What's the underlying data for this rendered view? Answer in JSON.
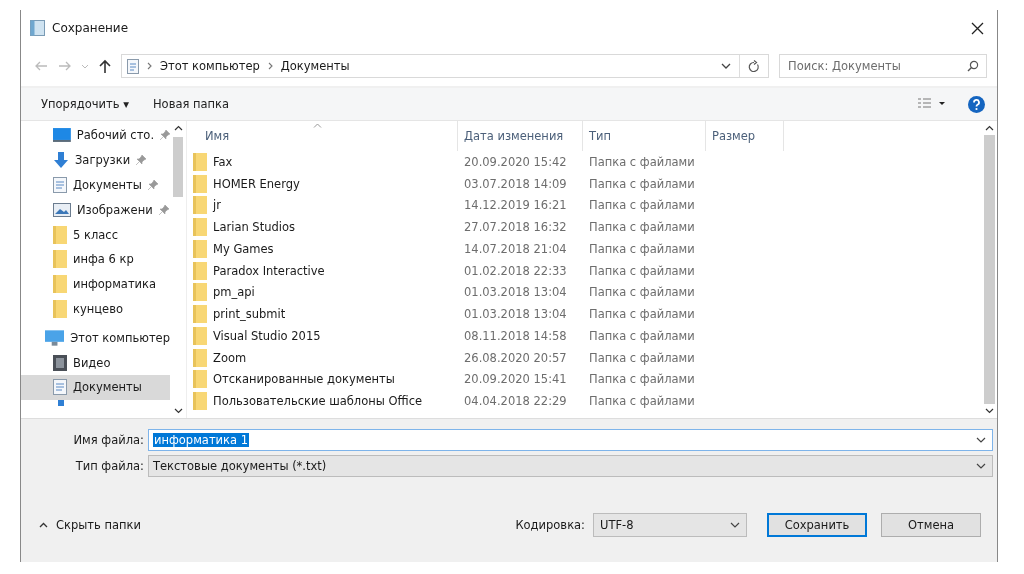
{
  "window": {
    "title": "Сохранение"
  },
  "address": {
    "path": [
      "Этот компьютер",
      "Документы"
    ]
  },
  "search": {
    "placeholder": "Поиск: Документы"
  },
  "toolbar": {
    "organize": "Упорядочить ▾",
    "new_folder": "Новая папка"
  },
  "sidebar": {
    "items": [
      {
        "label": "Рабочий сто.",
        "kind": "desktop",
        "pinned": true,
        "selected": false
      },
      {
        "label": "Загрузки",
        "kind": "download",
        "pinned": true,
        "selected": false
      },
      {
        "label": "Документы",
        "kind": "documents",
        "pinned": true,
        "selected": false
      },
      {
        "label": "Изображени",
        "kind": "pictures",
        "pinned": true,
        "selected": false
      },
      {
        "label": "5 класс",
        "kind": "folder",
        "pinned": false,
        "selected": false
      },
      {
        "label": "инфа 6 кр",
        "kind": "folder",
        "pinned": false,
        "selected": false
      },
      {
        "label": "информатика",
        "kind": "folder",
        "pinned": false,
        "selected": false
      },
      {
        "label": "кунцево",
        "kind": "folder",
        "pinned": false,
        "selected": false
      },
      {
        "label": "Этот компьютер",
        "kind": "computer",
        "pinned": false,
        "selected": false,
        "children": [
          {
            "label": "Видео",
            "kind": "video",
            "pinned": false,
            "selected": false
          },
          {
            "label": "Документы",
            "kind": "documents",
            "pinned": false,
            "selected": true
          }
        ]
      }
    ]
  },
  "table": {
    "columns": [
      "Имя",
      "Дата изменения",
      "Тип",
      "Размер"
    ],
    "rows": [
      {
        "name": "Fax",
        "date": "20.09.2020 15:42",
        "type": "Папка с файлами"
      },
      {
        "name": "HOMER Energy",
        "date": "03.07.2018 14:09",
        "type": "Папка с файлами"
      },
      {
        "name": "jr",
        "date": "14.12.2019 16:21",
        "type": "Папка с файлами"
      },
      {
        "name": "Larian Studios",
        "date": "27.07.2018 16:32",
        "type": "Папка с файлами"
      },
      {
        "name": "My Games",
        "date": "14.07.2018 21:04",
        "type": "Папка с файлами"
      },
      {
        "name": "Paradox Interactive",
        "date": "01.02.2018 22:33",
        "type": "Папка с файлами"
      },
      {
        "name": "pm_api",
        "date": "01.03.2018 13:04",
        "type": "Папка с файлами"
      },
      {
        "name": "print_submit",
        "date": "01.03.2018 13:04",
        "type": "Папка с файлами"
      },
      {
        "name": "Visual Studio 2015",
        "date": "08.11.2018 14:58",
        "type": "Папка с файлами"
      },
      {
        "name": "Zoom",
        "date": "26.08.2020 20:57",
        "type": "Папка с файлами"
      },
      {
        "name": "Отсканированные документы",
        "date": "20.09.2020 15:41",
        "type": "Папка с файлами"
      },
      {
        "name": "Пользовательские шаблоны Office",
        "date": "04.04.2018 22:29",
        "type": "Папка с файлами"
      }
    ]
  },
  "file_name": {
    "label": "Имя файла:",
    "value": "информатика 1"
  },
  "file_type": {
    "label": "Тип файла:",
    "value": "Текстовые документы (*.txt)"
  },
  "hide_folders": "Скрыть папки",
  "encoding": {
    "label": "Кодировка:",
    "value": "UTF-8"
  },
  "buttons": [
    "Сохранить",
    "Отмена"
  ]
}
